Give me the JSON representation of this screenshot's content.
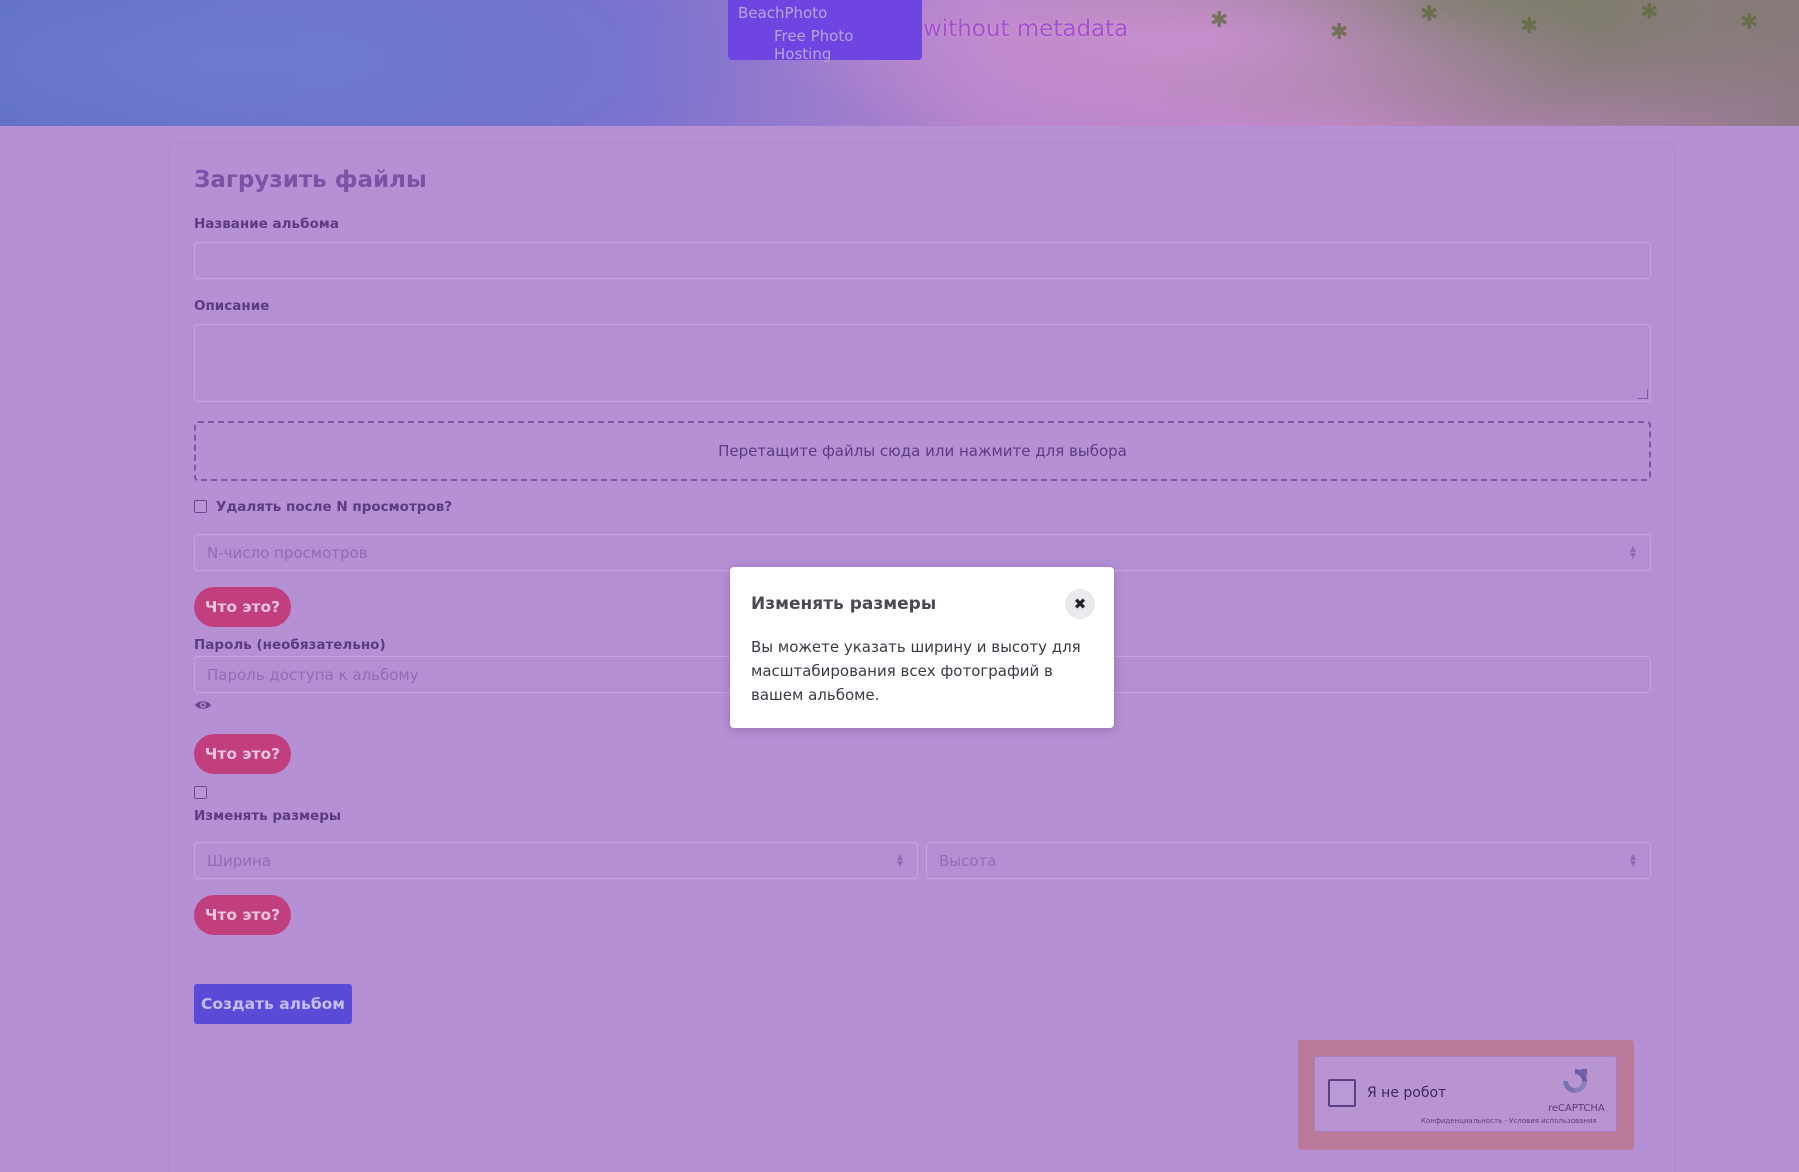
{
  "header": {
    "brand_name": "BeachPhoto",
    "brand_subtitle": "Free Photo Hosting",
    "tagline": "without metadata"
  },
  "form": {
    "title": "Загрузить файлы",
    "album_name_label": "Название альбома",
    "album_name_value": "",
    "description_label": "Описание",
    "description_value": "",
    "dropzone_text": "Перетащите файлы сюда или нажмите для выбора",
    "delete_after_views_label": "Удалять после N просмотров?",
    "views_placeholder": "N-число просмотров",
    "what_is_this_label": "Что это?",
    "password_label": "Пароль (необязательно)",
    "password_placeholder": "Пароль доступа к альбому",
    "resize_label": "Изменять размеры",
    "width_placeholder": "Ширина",
    "height_placeholder": "Высота",
    "submit_label": "Создать альбом"
  },
  "captcha": {
    "label": "Я не робот",
    "brand": "reCAPTCHA",
    "links": "Конфиденциальность - Условия использования"
  },
  "modal": {
    "title": "Изменять размеры",
    "close_symbol": "✖",
    "body": "Вы можете указать ширину и высоту для масштабирования всех фотографий в вашем альбоме."
  },
  "colors": {
    "overlay": "#b590d4",
    "accent_pill": "#c23f7d",
    "submit_button": "#5a4ad8",
    "brand_box": "#6e45e0"
  },
  "icons": {
    "eye": "eye-icon",
    "close": "close-icon",
    "recaptcha": "recaptcha-logo-icon"
  }
}
